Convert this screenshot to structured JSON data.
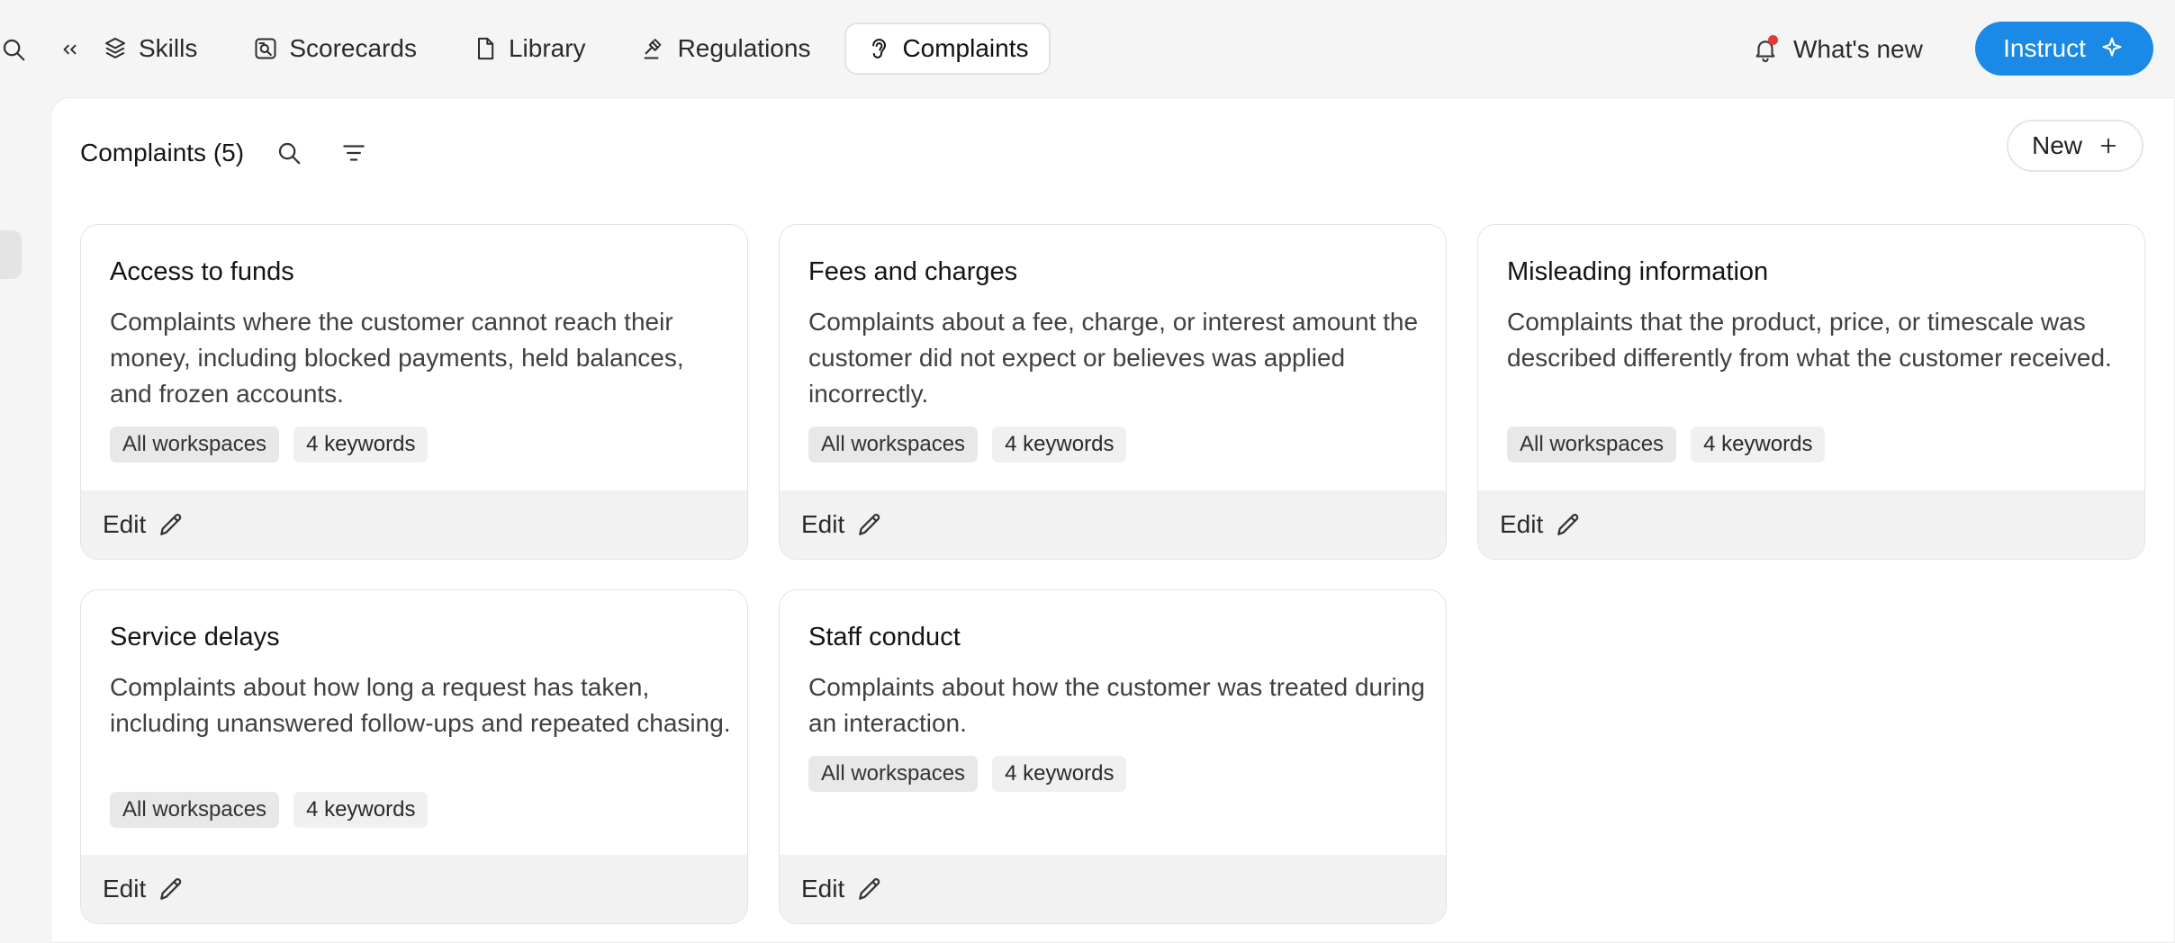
{
  "topbar": {
    "tabs": [
      {
        "label": "Skills",
        "icon": "cube-icon"
      },
      {
        "label": "Scorecards",
        "icon": "scorecard-icon"
      },
      {
        "label": "Library",
        "icon": "file-icon"
      },
      {
        "label": "Regulations",
        "icon": "gavel-icon"
      },
      {
        "label": "Complaints",
        "icon": "ear-icon",
        "active": true
      }
    ],
    "whats_new_label": "What's new",
    "instruct_label": "Instruct"
  },
  "panel": {
    "title": "Complaints (5)",
    "new_label": "New"
  },
  "cards": [
    {
      "title": "Access to funds",
      "description": "Complaints where the customer cannot reach their money, including blocked payments, held balances, and frozen accounts.",
      "scope": "All workspaces",
      "keywords": "4 keywords",
      "edit_label": "Edit"
    },
    {
      "title": "Fees and charges",
      "description": "Complaints about a fee, charge, or interest amount the customer did not expect or believes was applied incorrectly.",
      "scope": "All workspaces",
      "keywords": "4 keywords",
      "edit_label": "Edit"
    },
    {
      "title": "Misleading information",
      "description": "Complaints that the product, price, or timescale was described differently from what the customer received.",
      "scope": "All workspaces",
      "keywords": "4 keywords",
      "edit_label": "Edit"
    },
    {
      "title": "Service delays",
      "description": "Complaints about how long a request has taken, including unanswered follow-ups and repeated chasing.",
      "scope": "All workspaces",
      "keywords": "4 keywords",
      "edit_label": "Edit"
    },
    {
      "title": "Staff conduct",
      "description": "Complaints about how the customer was treated during an interaction.",
      "scope": "All workspaces",
      "keywords": "4 keywords",
      "edit_label": "Edit"
    }
  ],
  "colors": {
    "accent": "#1a8ae6",
    "notification_dot": "#e53935",
    "footer_bg": "#f2f2f2",
    "badge_bg": "#e8e8e8"
  }
}
